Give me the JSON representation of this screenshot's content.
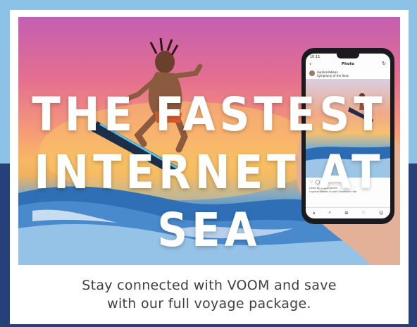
{
  "headline": {
    "line1": "THE FASTEST",
    "line2": "INTERNET AT SEA"
  },
  "caption": {
    "line1": "Stay connected with VOOM and save",
    "line2": "with our full voyage package."
  },
  "phone": {
    "status_time": "10:11",
    "title": "Photo",
    "username": "royalcaribbean",
    "location": "Symphony of the Seas",
    "liked_by": "Liked by ... and others",
    "caption_text": "royalcaribbean Sunset FlowRider ride"
  },
  "colors": {
    "frame_top": "#8cc2e6",
    "frame_bottom": "#25417a",
    "text": "#3f3f3f"
  }
}
